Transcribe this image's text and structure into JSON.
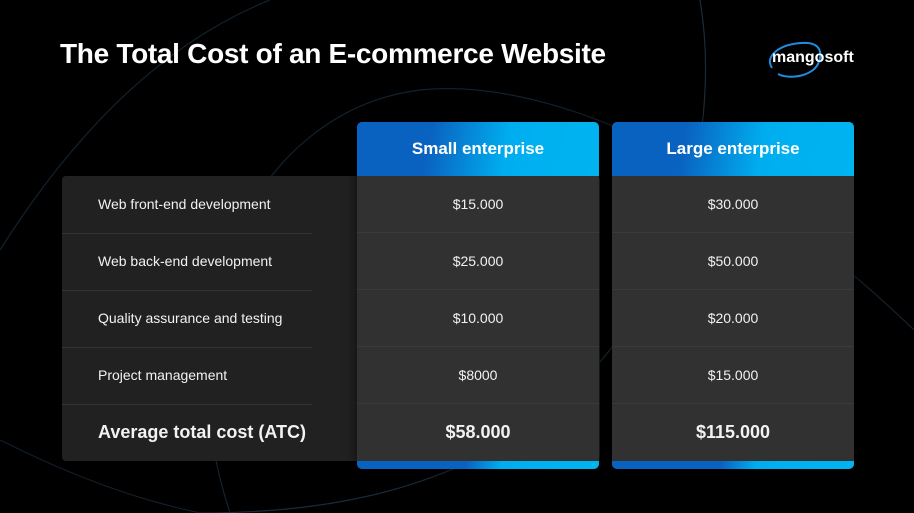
{
  "title": "The Total Cost of an E-commerce Website",
  "logo": {
    "text": "mangosoft",
    "accent": "#1e8fe0"
  },
  "colors": {
    "header_start": "#0a62c0",
    "header_end": "#00b4f0",
    "panel": "#212121",
    "column": "#313131"
  },
  "table": {
    "columns": [
      "Small enterprise",
      "Large enterprise"
    ],
    "rows": [
      {
        "label": "Web front-end development",
        "values": [
          "$15.000",
          "$30.000"
        ]
      },
      {
        "label": "Web back-end development",
        "values": [
          "$25.000",
          "$50.000"
        ]
      },
      {
        "label": "Quality assurance and testing",
        "values": [
          "$10.000",
          "$20.000"
        ]
      },
      {
        "label": "Project management",
        "values": [
          "$8000",
          "$15.000"
        ]
      }
    ],
    "total": {
      "label": "Average total cost (ATC)",
      "values": [
        "$58.000",
        "$115.000"
      ]
    }
  }
}
